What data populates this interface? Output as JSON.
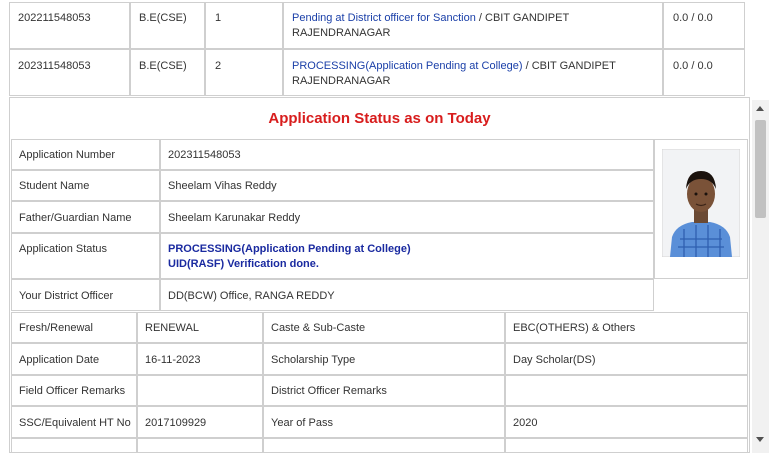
{
  "top_rows": [
    {
      "app_no": "202211548053",
      "course": "B.E(CSE)",
      "year": "1",
      "status_link": "Pending at District officer for Sanction",
      "sep": " / ",
      "college_l1": "CBIT GANDIPET",
      "college_l2": "RAJENDRANAGAR",
      "amount": "0.0 / 0.0"
    },
    {
      "app_no": "202311548053",
      "course": "B.E(CSE)",
      "year": "2",
      "status_link": "PROCESSING(Application Pending at College)",
      "sep": " / ",
      "college_l1": "CBIT GANDIPET",
      "college_l2": "RAJENDRANAGAR",
      "amount": "0.0 / 0.0"
    }
  ],
  "status": {
    "title": "Application Status as on Today",
    "rows": {
      "app_number_label": "Application Number",
      "app_number": "202311548053",
      "student_name_label": "Student Name",
      "student_name": "Sheelam Vihas Reddy",
      "father_label": "Father/Guardian Name",
      "father": "Sheelam Karunakar Reddy",
      "app_status_label": "Application Status",
      "app_status_l1": "PROCESSING(Application Pending at College)",
      "app_status_l2": "UID(RASF) Verification done.",
      "district_officer_label": "Your District Officer",
      "district_officer": "DD(BCW) Office, RANGA REDDY",
      "fresh_label": "Fresh/Renewal",
      "fresh": "RENEWAL",
      "caste_label": "Caste & Sub-Caste",
      "caste": "EBC(OTHERS) & Others",
      "app_date_label": "Application Date",
      "app_date": "16-11-2023",
      "scholarship_label": "Scholarship Type",
      "scholarship": "Day Scholar(DS)",
      "field_officer_label": "Field Officer Remarks",
      "field_officer": "",
      "district_remarks_label": "District Officer Remarks",
      "district_remarks": "",
      "ssc_label": "SSC/Equivalent HT No",
      "ssc": "2017109929",
      "year_pass_label": "Year of Pass",
      "year_pass": "2020"
    }
  },
  "colors": {
    "title": "#d81d1d",
    "link": "#1a3fa8",
    "status": "#1a2aa0"
  }
}
